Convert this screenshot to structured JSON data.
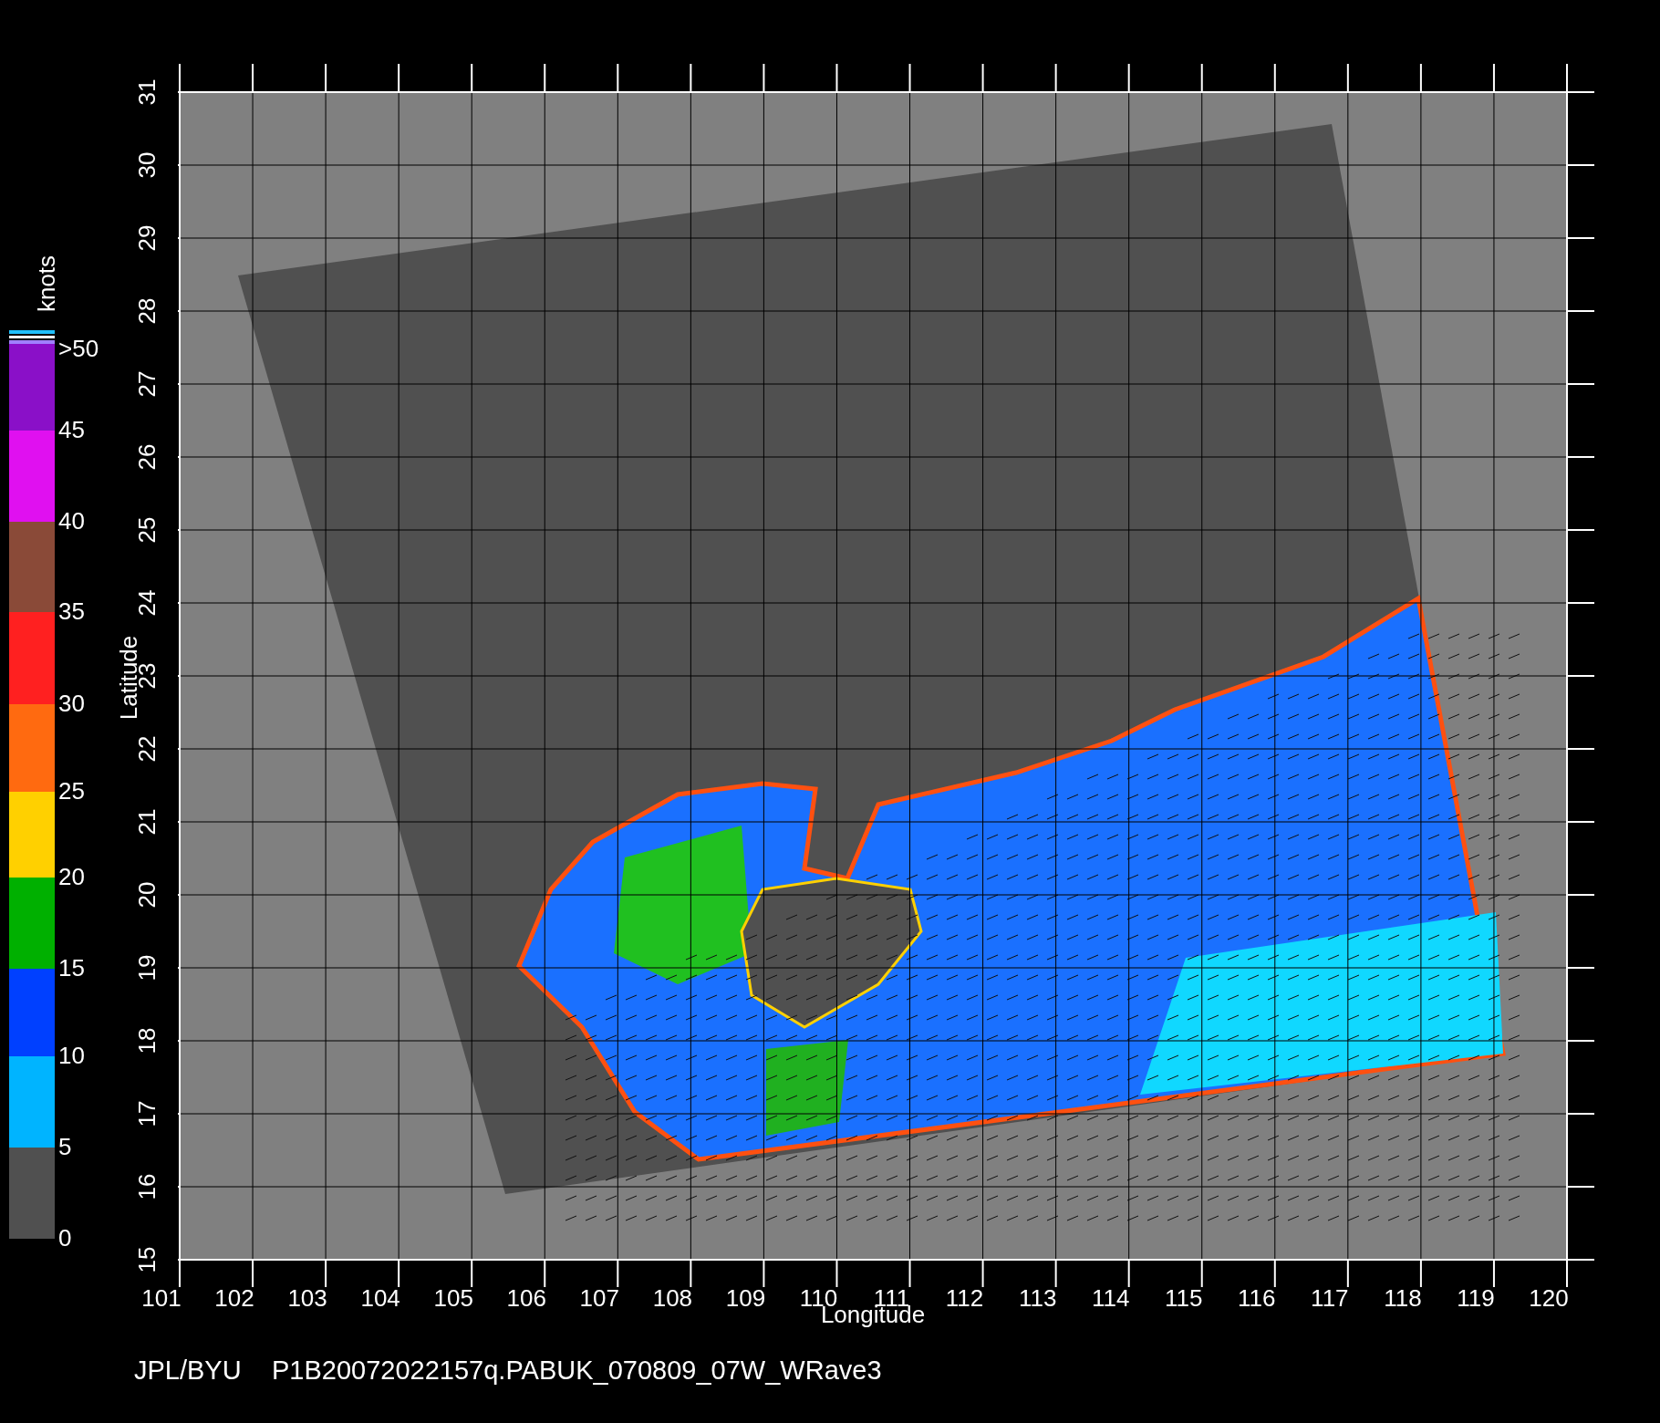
{
  "map": {
    "x_axis": {
      "label": "Longitude",
      "ticks": [
        "101",
        "102",
        "103",
        "104",
        "105",
        "106",
        "107",
        "108",
        "109",
        "110",
        "111",
        "112",
        "113",
        "114",
        "115",
        "116",
        "117",
        "118",
        "119",
        "120"
      ]
    },
    "y_axis": {
      "label": "Latitude",
      "ticks": [
        "15",
        "16",
        "17",
        "18",
        "19",
        "20",
        "21",
        "22",
        "23",
        "24",
        "25",
        "26",
        "27",
        "28",
        "29",
        "30",
        "31"
      ]
    }
  },
  "colorbar": {
    "unit": "knots",
    "labels": [
      ">50",
      "45",
      "40",
      "35",
      "30",
      "25",
      "20",
      "15",
      "10",
      "5",
      "0"
    ],
    "bands": [
      {
        "color": "#8a10c8"
      },
      {
        "color": "#e010f0"
      },
      {
        "color": "#8a4a38"
      },
      {
        "color": "#ff2020"
      },
      {
        "color": "#ff6a10"
      },
      {
        "color": "#ffd000"
      },
      {
        "color": "#00b000"
      },
      {
        "color": "#0040ff"
      },
      {
        "color": "#00b4ff"
      },
      {
        "color": "#505050"
      }
    ]
  },
  "caption": {
    "source": "JPL/BYU",
    "file": "P1B20072022157q.PABUK_070809_07W_WRave3"
  }
}
